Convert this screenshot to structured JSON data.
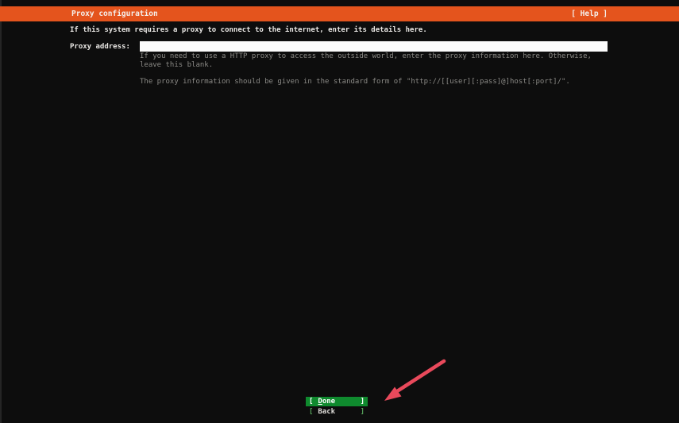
{
  "header": {
    "title": "Proxy configuration",
    "help_label": "[ Help ]"
  },
  "content": {
    "instruction": "If this system requires a proxy to connect to the internet, enter its details here.",
    "form": {
      "label": "Proxy address:",
      "input_value": "",
      "help_line1": "If you need to use a HTTP proxy to access the outside world, enter the proxy information here. Otherwise,",
      "help_line2": "leave this blank.",
      "help_line3": "The proxy information should be given in the standard form of \"http://[[user][:pass]@]host[:port]/\"."
    }
  },
  "footer": {
    "done": {
      "bracket_left": "[",
      "label": "Done",
      "bracket_right": "]"
    },
    "back": {
      "bracket_left": "[",
      "label": "Back",
      "bracket_right": "]"
    }
  },
  "annotation": {
    "arrow_color": "#e8495b"
  },
  "colors": {
    "background": "#0d0d0d",
    "header_bg": "#e4541d",
    "accent_green": "#0f8a2e",
    "input_bg": "#fbfbfb"
  }
}
